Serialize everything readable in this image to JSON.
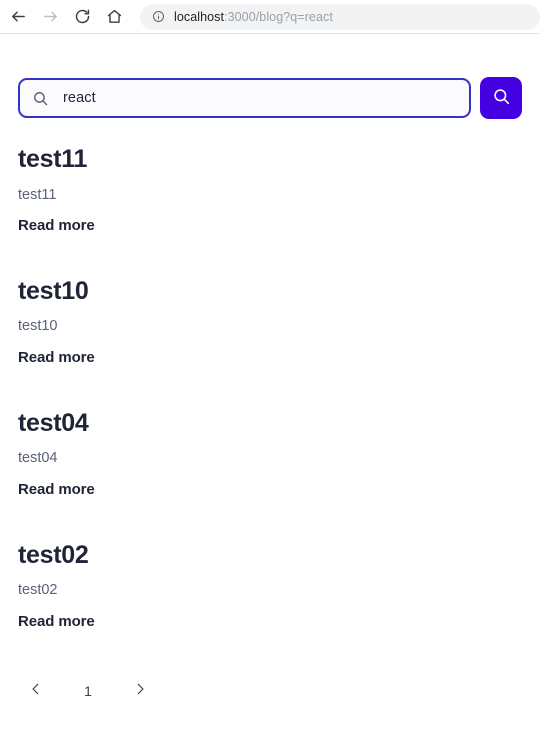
{
  "browser": {
    "back_label": "Back",
    "forward_label": "Forward",
    "reload_label": "Reload",
    "home_label": "Home",
    "url_host": "localhost",
    "url_rest": ":3000/blog?q=react",
    "url_full": "localhost:3000/blog?q=react",
    "icons": {
      "back": "back-arrow-icon",
      "forward": "forward-arrow-icon",
      "reload": "reload-icon",
      "home": "home-icon",
      "info": "info-circle-icon"
    }
  },
  "search": {
    "value": "react",
    "placeholder": "Search",
    "input_icon": "search-icon",
    "button_icon": "search-icon",
    "button_label": "Search",
    "button_color": "#4400e0",
    "focus_border_color": "#3832c4"
  },
  "posts": [
    {
      "title": "test11",
      "excerpt": "test11",
      "read_more": "Read more"
    },
    {
      "title": "test10",
      "excerpt": "test10",
      "read_more": "Read more"
    },
    {
      "title": "test04",
      "excerpt": "test04",
      "read_more": "Read more"
    },
    {
      "title": "test02",
      "excerpt": "test02",
      "read_more": "Read more"
    }
  ],
  "pagination": {
    "prev_label": "Previous page",
    "next_label": "Next page",
    "current_page": "1",
    "prev_icon": "chevron-left-icon",
    "next_icon": "chevron-right-icon"
  },
  "theme": {
    "text_dark": "#1f2437",
    "text_muted": "#5a6278",
    "accent": "#4400e0"
  }
}
